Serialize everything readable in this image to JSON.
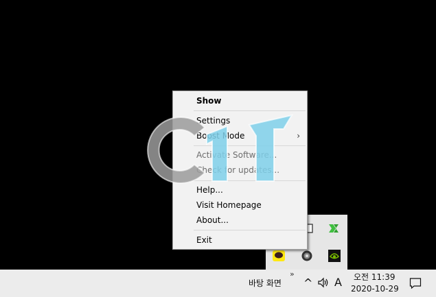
{
  "menu": {
    "items": [
      {
        "label": "Show",
        "bold": true,
        "disabled": false
      },
      {
        "label": "Settings",
        "bold": false,
        "disabled": false
      },
      {
        "label": "Boost Mode",
        "bold": false,
        "disabled": false,
        "submenu": true
      },
      {
        "label": "Activate Software...",
        "bold": false,
        "disabled": true
      },
      {
        "label": "Check for updates...",
        "bold": false,
        "disabled": true
      },
      {
        "label": "Help...",
        "bold": false,
        "disabled": false
      },
      {
        "label": "Visit Homepage",
        "bold": false,
        "disabled": false
      },
      {
        "label": "About...",
        "bold": false,
        "disabled": false
      },
      {
        "label": "Exit",
        "bold": false,
        "disabled": false
      }
    ],
    "submenu_glyph": "›"
  },
  "taskbar": {
    "desktop_label": "바탕 화면",
    "show_hidden_glyph": "»",
    "chevron_glyph": "^",
    "input_indicator": "A",
    "time": "오전 11:39",
    "date": "2020-10-29"
  },
  "colors": {
    "desktop_bg": "#000000",
    "menu_bg": "#f2f2f2",
    "taskbar_bg": "#ececec",
    "flyout_bg": "#e6e6e6",
    "kakao_yellow": "#ffe812",
    "nvidia_green": "#76b900",
    "hash_green": "#3fbf3f"
  },
  "icons": {
    "flyout": [
      "window-icon",
      "hash-green-icon",
      "kakaotalk-icon",
      "disc-icon",
      "nvidia-share-icon"
    ],
    "taskbar": [
      "volume-icon",
      "notification-icon"
    ]
  }
}
